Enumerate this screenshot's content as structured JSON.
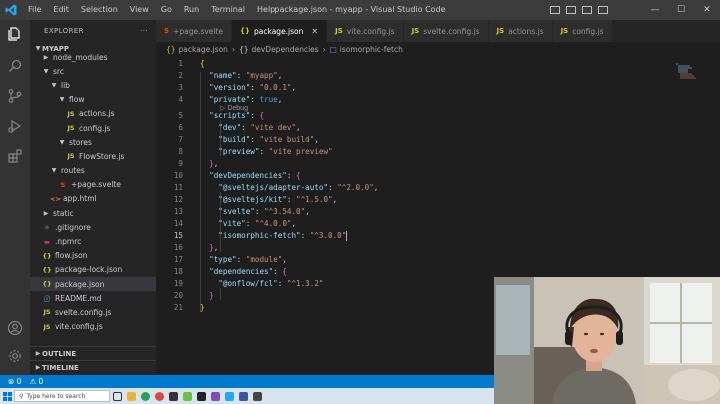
{
  "titlebar": {
    "menus": [
      "File",
      "Edit",
      "Selection",
      "View",
      "Go",
      "Run",
      "Terminal",
      "Help"
    ],
    "title": "package.json - myapp - Visual Studio Code"
  },
  "sidebar": {
    "header": "EXPLORER",
    "root": "MYAPP",
    "items": [
      {
        "label": "node_modules",
        "kind": "folder",
        "depth": 1,
        "open": false
      },
      {
        "label": "src",
        "kind": "folder",
        "depth": 1,
        "open": true
      },
      {
        "label": "lib",
        "kind": "folder",
        "depth": 2,
        "open": true
      },
      {
        "label": "flow",
        "kind": "folder",
        "depth": 3,
        "open": true
      },
      {
        "label": "actions.js",
        "kind": "js",
        "depth": 4
      },
      {
        "label": "config.js",
        "kind": "js",
        "depth": 4
      },
      {
        "label": "stores",
        "kind": "folder",
        "depth": 3,
        "open": true
      },
      {
        "label": "FlowStore.js",
        "kind": "js",
        "depth": 4
      },
      {
        "label": "routes",
        "kind": "folder",
        "depth": 2,
        "open": true
      },
      {
        "label": "+page.svelte",
        "kind": "svelte",
        "depth": 3
      },
      {
        "label": "app.html",
        "kind": "html",
        "depth": 2
      },
      {
        "label": "static",
        "kind": "folder",
        "depth": 1,
        "open": false
      },
      {
        "label": ".gitignore",
        "kind": "git",
        "depth": 1
      },
      {
        "label": ".npmrc",
        "kind": "npm",
        "depth": 1
      },
      {
        "label": "flow.json",
        "kind": "json",
        "depth": 1
      },
      {
        "label": "package-lock.json",
        "kind": "json",
        "depth": 1
      },
      {
        "label": "package.json",
        "kind": "json",
        "depth": 1,
        "active": true
      },
      {
        "label": "README.md",
        "kind": "md",
        "depth": 1
      },
      {
        "label": "svelte.config.js",
        "kind": "js",
        "depth": 1
      },
      {
        "label": "vite.config.js",
        "kind": "js",
        "depth": 1
      }
    ],
    "outline": "OUTLINE",
    "timeline": "TIMELINE"
  },
  "tabs": [
    {
      "label": "+page.svelte",
      "kind": "svelte"
    },
    {
      "label": "package.json",
      "kind": "json",
      "active": true
    },
    {
      "label": "vite.config.js",
      "kind": "js"
    },
    {
      "label": "svelte.config.js",
      "kind": "js"
    },
    {
      "label": "actions.js",
      "kind": "js"
    },
    {
      "label": "config.js",
      "kind": "js"
    }
  ],
  "breadcrumb": {
    "file_icon": "{}",
    "file": "package.json",
    "node_icon": "{}",
    "node": "devDependencies",
    "leaf_icon": "□",
    "leaf": "isomorphic-fetch"
  },
  "editor": {
    "debug_lens": "▷ Debug",
    "current_line": 15,
    "lines": [
      {
        "n": "1",
        "t": [
          [
            "{",
            "br1"
          ]
        ]
      },
      {
        "n": "2",
        "t": [
          [
            "  ",
            "p"
          ],
          [
            "\"name\"",
            "k"
          ],
          [
            ": ",
            "p"
          ],
          [
            "\"myapp\"",
            "s"
          ],
          [
            ",",
            "p"
          ]
        ]
      },
      {
        "n": "3",
        "t": [
          [
            "  ",
            "p"
          ],
          [
            "\"version\"",
            "k"
          ],
          [
            ": ",
            "p"
          ],
          [
            "\"0.0.1\"",
            "s"
          ],
          [
            ",",
            "p"
          ]
        ]
      },
      {
        "n": "4",
        "t": [
          [
            "  ",
            "p"
          ],
          [
            "\"private\"",
            "k"
          ],
          [
            ": ",
            "p"
          ],
          [
            "true",
            "b"
          ],
          [
            ",",
            "p"
          ]
        ]
      },
      {
        "n": "5",
        "t": [
          [
            "  ",
            "p"
          ],
          [
            "\"scripts\"",
            "k"
          ],
          [
            ": ",
            "p"
          ],
          [
            "{",
            "br2"
          ]
        ]
      },
      {
        "n": "6",
        "t": [
          [
            "    ",
            "p"
          ],
          [
            "\"dev\"",
            "k"
          ],
          [
            ": ",
            "p"
          ],
          [
            "\"vite dev\"",
            "s"
          ],
          [
            ",",
            "p"
          ]
        ]
      },
      {
        "n": "7",
        "t": [
          [
            "    ",
            "p"
          ],
          [
            "\"build\"",
            "k"
          ],
          [
            ": ",
            "p"
          ],
          [
            "\"vite build\"",
            "s"
          ],
          [
            ",",
            "p"
          ]
        ]
      },
      {
        "n": "8",
        "t": [
          [
            "    ",
            "p"
          ],
          [
            "\"preview\"",
            "k"
          ],
          [
            ": ",
            "p"
          ],
          [
            "\"vite preview\"",
            "s"
          ]
        ]
      },
      {
        "n": "9",
        "t": [
          [
            "  ",
            "p"
          ],
          [
            "}",
            "br2"
          ],
          [
            ",",
            "p"
          ]
        ]
      },
      {
        "n": "10",
        "t": [
          [
            "  ",
            "p"
          ],
          [
            "\"devDependencies\"",
            "k"
          ],
          [
            ": ",
            "p"
          ],
          [
            "{",
            "br2"
          ]
        ]
      },
      {
        "n": "11",
        "t": [
          [
            "    ",
            "p"
          ],
          [
            "\"@sveltejs/adapter-auto\"",
            "k"
          ],
          [
            ": ",
            "p"
          ],
          [
            "\"^2.0.0\"",
            "s"
          ],
          [
            ",",
            "p"
          ]
        ]
      },
      {
        "n": "12",
        "t": [
          [
            "    ",
            "p"
          ],
          [
            "\"@sveltejs/kit\"",
            "k"
          ],
          [
            ": ",
            "p"
          ],
          [
            "\"^1.5.0\"",
            "s"
          ],
          [
            ",",
            "p"
          ]
        ]
      },
      {
        "n": "13",
        "t": [
          [
            "    ",
            "p"
          ],
          [
            "\"svelte\"",
            "k"
          ],
          [
            ": ",
            "p"
          ],
          [
            "\"^3.54.0\"",
            "s"
          ],
          [
            ",",
            "p"
          ]
        ]
      },
      {
        "n": "14",
        "t": [
          [
            "    ",
            "p"
          ],
          [
            "\"vite\"",
            "k"
          ],
          [
            ": ",
            "p"
          ],
          [
            "\"^4.0.0\"",
            "s"
          ],
          [
            ",",
            "p"
          ]
        ]
      },
      {
        "n": "15",
        "t": [
          [
            "    ",
            "p"
          ],
          [
            "\"isomorphic-fetch\"",
            "k"
          ],
          [
            ": ",
            "p"
          ],
          [
            "\"^3.0.0\"",
            "s"
          ]
        ]
      },
      {
        "n": "16",
        "t": [
          [
            "  ",
            "p"
          ],
          [
            "}",
            "br2"
          ],
          [
            ",",
            "p"
          ]
        ]
      },
      {
        "n": "17",
        "t": [
          [
            "  ",
            "p"
          ],
          [
            "\"type\"",
            "k"
          ],
          [
            ": ",
            "p"
          ],
          [
            "\"module\"",
            "s"
          ],
          [
            ",",
            "p"
          ]
        ]
      },
      {
        "n": "18",
        "t": [
          [
            "  ",
            "p"
          ],
          [
            "\"dependencies\"",
            "k"
          ],
          [
            ": ",
            "p"
          ],
          [
            "{",
            "br2"
          ]
        ]
      },
      {
        "n": "19",
        "t": [
          [
            "    ",
            "p"
          ],
          [
            "\"@onflow/fcl\"",
            "k"
          ],
          [
            ": ",
            "p"
          ],
          [
            "\"^1.3.2\"",
            "s"
          ]
        ]
      },
      {
        "n": "20",
        "t": [
          [
            "  ",
            "p"
          ],
          [
            "}",
            "br2"
          ]
        ]
      },
      {
        "n": "21",
        "t": [
          [
            "}",
            "br1"
          ]
        ]
      }
    ]
  },
  "statusbar": {
    "errors": "⊗ 0",
    "warnings": "⚠ 0"
  },
  "taskbar": {
    "search_placeholder": "Type here to search"
  },
  "colors": {
    "accent": "#007acc",
    "titlebar": "#3c3c3c",
    "activitybar": "#333333",
    "sidebar": "#252526",
    "editor": "#1e1e1e"
  },
  "icons": {
    "activity": [
      "explorer-icon",
      "search-icon",
      "source-control-icon",
      "run-debug-icon",
      "extensions-icon",
      "account-icon",
      "settings-gear-icon"
    ]
  }
}
